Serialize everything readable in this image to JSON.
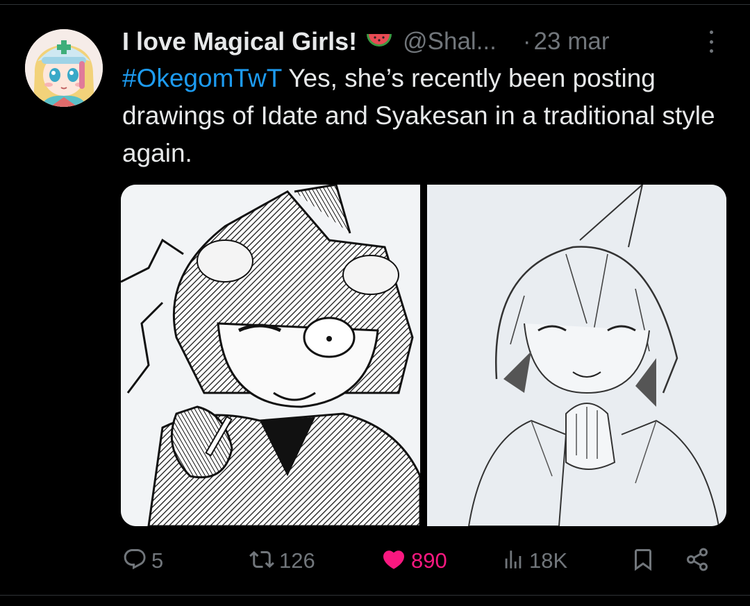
{
  "tweet": {
    "author": {
      "display_name": "I love Magical Girls!",
      "handle": "@Shal...",
      "avatar_icon": "avatar",
      "emoji_icon": "watermelon-icon"
    },
    "separator": "·",
    "date": "23 mar",
    "hashtag": "#OkegomTwT",
    "text": " Yes, she’s recently been posting drawings of Idate and Syakesan in a traditional style again.",
    "media": [
      {
        "description_icon": "ink-drawing-left"
      },
      {
        "description_icon": "pencil-drawing-right"
      }
    ],
    "actions": {
      "replies": "5",
      "retweets": "126",
      "likes": "890",
      "views": "18K"
    }
  },
  "colors": {
    "background": "#000000",
    "text": "#e7e9ea",
    "muted": "#71767b",
    "link": "#1d9bf0",
    "like": "#f91880",
    "divider": "#2f3336"
  }
}
